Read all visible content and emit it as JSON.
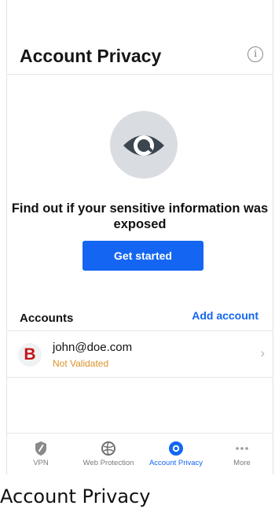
{
  "header": {
    "title": "Account Privacy",
    "info_icon": "info-icon",
    "info_glyph": "i"
  },
  "hero": {
    "icon": "eye-icon",
    "message": "Find out if your sensitive information was exposed",
    "cta_label": "Get started"
  },
  "accounts": {
    "label": "Accounts",
    "add_label": "Add account",
    "items": [
      {
        "avatar_letter": "B",
        "email": "john@doe.com",
        "status": "Not Validated"
      }
    ]
  },
  "tabbar": {
    "tabs": [
      {
        "label": "VPN",
        "icon": "shield-icon",
        "active": false
      },
      {
        "label": "Web Protection",
        "icon": "globe-icon",
        "active": false
      },
      {
        "label": "Account Privacy",
        "icon": "eye-icon",
        "active": true
      },
      {
        "label": "More",
        "icon": "more-icon",
        "active": false
      }
    ]
  },
  "caption": "Account Privacy",
  "colors": {
    "accent": "#1466f2",
    "warning": "#d9942a",
    "brand_red": "#c11818",
    "icon_bg": "#d9dde2",
    "icon_dark": "#3c4650"
  }
}
